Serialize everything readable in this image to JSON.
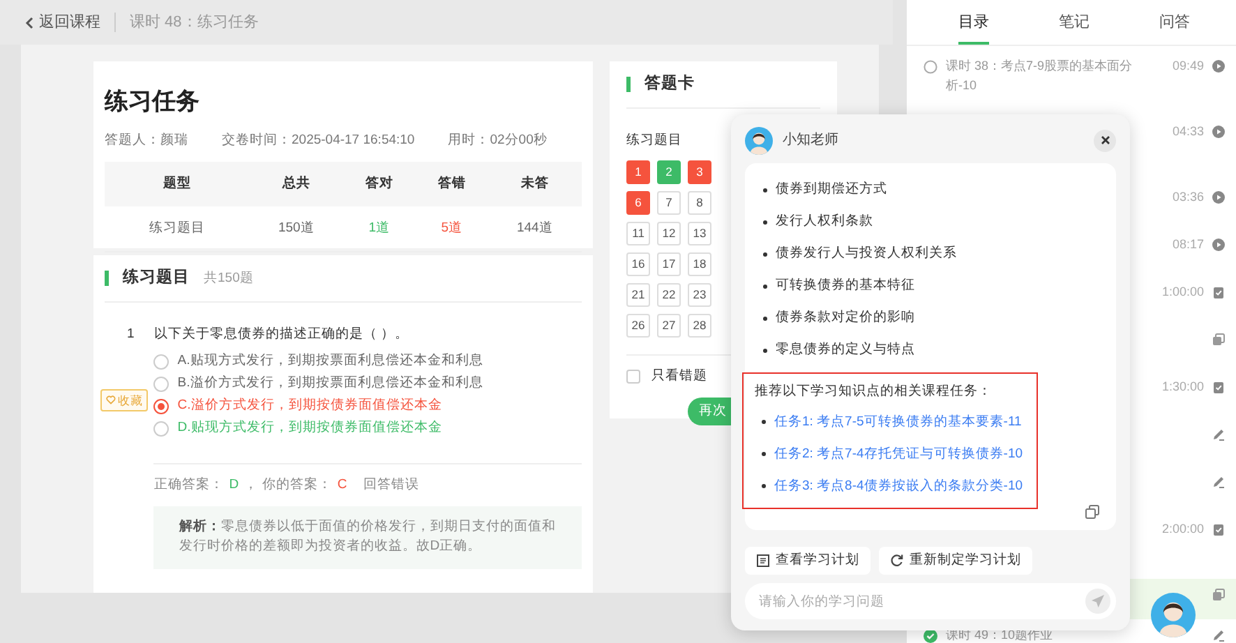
{
  "topbar": {
    "back": "返回课程",
    "title": "课时 48：练习任务"
  },
  "result": {
    "title": "练习任务",
    "meta": [
      {
        "label": "答题人：",
        "value": "颜瑞"
      },
      {
        "label": "交卷时间：",
        "value": "2025-04-17 16:54:10"
      },
      {
        "label": "用时：",
        "value": "02分00秒"
      }
    ],
    "table": {
      "columns": [
        "题型",
        "总共",
        "答对",
        "答错",
        "未答"
      ],
      "rows": [
        [
          {
            "text": "练习题目",
            "kind": "plain"
          },
          {
            "text": "150道",
            "kind": "plain"
          },
          {
            "text": "1道",
            "kind": "correct"
          },
          {
            "text": "5道",
            "kind": "wrong"
          },
          {
            "text": "144道",
            "kind": "plain"
          }
        ]
      ]
    }
  },
  "questions": {
    "title": "练习题目",
    "count": "共150题",
    "items": [
      {
        "number": "1",
        "text": "以下关于零息债券的描述正确的是（ ）。",
        "favorite": "收藏",
        "options": [
          {
            "text": "A.贴现方式发行，到期按票面利息偿还本金和利息",
            "selected": false,
            "kind": "plain"
          },
          {
            "text": "B.溢价方式发行，到期按票面利息偿还本金和利息",
            "selected": false,
            "kind": "plain"
          },
          {
            "text": "C.溢价方式发行，到期按债券面值偿还本金",
            "selected": true,
            "kind": "wrong"
          },
          {
            "text": "D.贴现方式发行，到期按债券面值偿还本金",
            "selected": false,
            "kind": "correct"
          }
        ],
        "correct_label": "正确答案：",
        "correct": "D",
        "yours_label": "，  你的答案：",
        "yours": "C",
        "verdict": "回答错误",
        "analysis_label": "解析：",
        "analysis": "零息债券以低于面值的价格发行，到期日支付的面值和发行时价格的差额即为投资者的收益。故D正确。"
      }
    ]
  },
  "answer_card": {
    "title": "答题卡",
    "section": "练习题目",
    "cells": [
      {
        "number": "1",
        "answered": true,
        "correct": false
      },
      {
        "number": "2",
        "answered": true,
        "correct": true
      },
      {
        "number": "3",
        "answered": true,
        "correct": false
      },
      {
        "number": "6",
        "answered": true,
        "correct": false
      },
      {
        "number": "7",
        "answered": false
      },
      {
        "number": "8",
        "answered": false
      },
      {
        "number": "11",
        "answered": false
      },
      {
        "number": "12",
        "answered": false
      },
      {
        "number": "13",
        "answered": false
      },
      {
        "number": "16",
        "answered": false
      },
      {
        "number": "17",
        "answered": false
      },
      {
        "number": "18",
        "answered": false
      },
      {
        "number": "21",
        "answered": false
      },
      {
        "number": "22",
        "answered": false
      },
      {
        "number": "23",
        "answered": false
      },
      {
        "number": "26",
        "answered": false
      },
      {
        "number": "27",
        "answered": false
      },
      {
        "number": "28",
        "answered": false
      }
    ],
    "wrong_only": {
      "label": "只看错题",
      "checked": false
    },
    "retry": "再次"
  },
  "sidebar": {
    "tabs": [
      {
        "label": "目录",
        "selected": true
      },
      {
        "label": "笔记",
        "selected": false
      },
      {
        "label": "问答",
        "selected": false
      }
    ],
    "lessons": [
      {
        "done": false,
        "title": "课时 38：考点7-9股票的基本面分析-10",
        "time": "09:49",
        "kind": "video",
        "selected": false
      },
      {
        "time": "04:33",
        "kind": "video",
        "selected": false
      },
      {
        "time": "03:36",
        "kind": "video",
        "selected": false
      },
      {
        "time": "08:17",
        "kind": "video",
        "selected": false
      },
      {
        "time": "1:00:00",
        "kind": "exam",
        "selected": false
      },
      {
        "kind": "doc",
        "selected": false
      },
      {
        "time": "1:30:00",
        "kind": "exam",
        "selected": false
      },
      {
        "kind": "homework",
        "selected": false
      },
      {
        "kind": "homework",
        "selected": false
      },
      {
        "time": "2:00:00",
        "kind": "exam",
        "selected": false
      },
      {
        "kind": "doc",
        "selected": true
      },
      {
        "done": true,
        "title": "课时 49：10题作业",
        "kind": "homework",
        "selected": false
      }
    ]
  },
  "chat": {
    "name": "小知老师",
    "bullets": [
      "债券到期偿还方式",
      "发行人权利条款",
      "债券发行人与投资人权利关系",
      "可转换债券的基本特征",
      "债券条款对定价的影响",
      "零息债券的定义与特点"
    ],
    "recommend": {
      "heading": "推荐以下学习知识点的相关课程任务：",
      "tasks": [
        "任务1: 考点7-5可转换债券的基本要素-11",
        "任务2: 考点7-4存托凭证与可转换债券-10",
        "任务3: 考点8-4债券按嵌入的条款分类-10"
      ]
    },
    "actions": [
      {
        "label": "查看学习计划",
        "kind": "plan"
      },
      {
        "label": "重新制定学习计划",
        "kind": "refresh"
      }
    ],
    "input": {
      "placeholder": "请输入你的学习问题"
    }
  }
}
